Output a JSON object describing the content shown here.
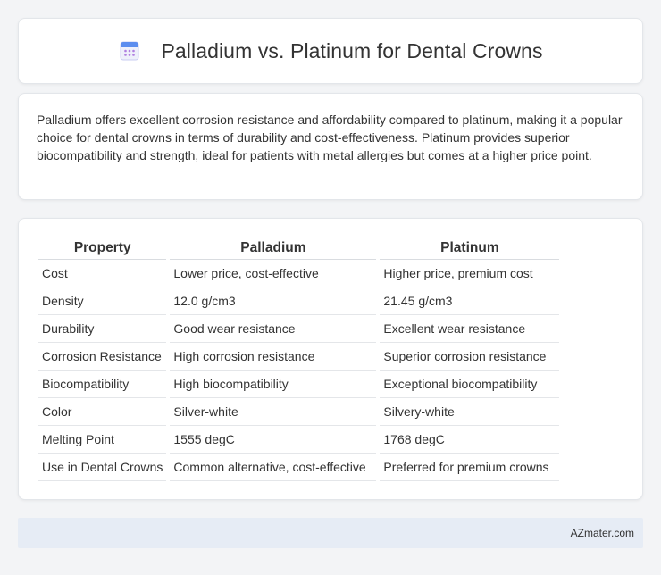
{
  "header": {
    "title": "Palladium vs. Platinum for Dental Crowns",
    "icon": "calendar-icon"
  },
  "description": "Palladium offers excellent corrosion resistance and affordability compared to platinum, making it a popular choice for dental crowns in terms of durability and cost-effectiveness. Platinum provides superior biocompatibility and strength, ideal for patients with metal allergies but comes at a higher price point.",
  "table": {
    "headers": [
      "Property",
      "Palladium",
      "Platinum"
    ],
    "rows": [
      [
        "Cost",
        "Lower price, cost-effective",
        "Higher price, premium cost"
      ],
      [
        "Density",
        "12.0 g/cm3",
        "21.45 g/cm3"
      ],
      [
        "Durability",
        "Good wear resistance",
        "Excellent wear resistance"
      ],
      [
        "Corrosion Resistance",
        "High corrosion resistance",
        "Superior corrosion resistance"
      ],
      [
        "Biocompatibility",
        "High biocompatibility",
        "Exceptional biocompatibility"
      ],
      [
        "Color",
        "Silver-white",
        "Silvery-white"
      ],
      [
        "Melting Point",
        "1555 degC",
        "1768 degC"
      ],
      [
        "Use in Dental Crowns",
        "Common alternative, cost-effective",
        "Preferred for premium crowns"
      ]
    ]
  },
  "footer": {
    "brand": "AZmater.com"
  },
  "colors": {
    "background": "#f3f4f6",
    "card": "#ffffff",
    "footer_bg": "#e6ecf5",
    "icon_blue": "#5b8def",
    "icon_purple": "#b07fe0"
  }
}
